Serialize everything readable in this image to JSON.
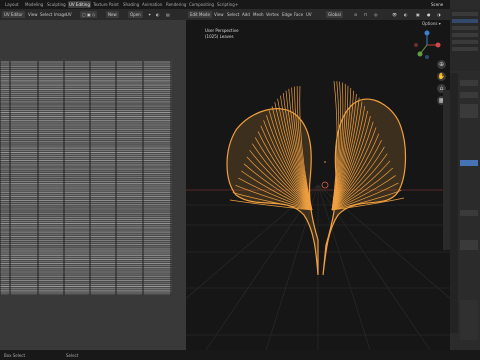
{
  "workspace_tabs": [
    "Layout",
    "Modeling",
    "Sculpting",
    "UV Editing",
    "Texture Paint",
    "Shading",
    "Animation",
    "Rendering",
    "Compositing",
    "Scripting"
  ],
  "scene_label": "Scene",
  "uv_header": {
    "mode": "UV Editor",
    "menus": [
      "View",
      "Select",
      "Image",
      "UV"
    ],
    "new_label": "New",
    "open_label": "Open"
  },
  "viewport_header": {
    "mode": "Edit Mode",
    "menus": [
      "View",
      "Select",
      "Add",
      "Mesh",
      "Vertex",
      "Edge",
      "Face",
      "UV"
    ],
    "transform": "Global",
    "options_label": "Options"
  },
  "viewport_overlay": {
    "line1": "User Perspective",
    "line2": "(1025) Leaves"
  },
  "status_bar": {
    "left": "Box Select",
    "mid": "Select"
  },
  "colors": {
    "accent": "#4772b3",
    "selection": "#f0a040"
  }
}
